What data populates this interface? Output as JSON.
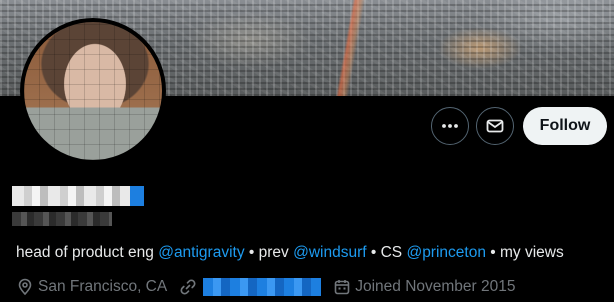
{
  "profile": {
    "bio": {
      "prefix": "head of product eng",
      "mention1": "@antigravity",
      "sep1": "• prev",
      "mention2": "@windsurf",
      "sep2": "• CS",
      "mention3": "@princeton",
      "suffix": "• my views"
    },
    "location": "San Francisco, CA",
    "joined": "Joined November 2015"
  },
  "actions": {
    "follow_label": "Follow"
  },
  "icons": {
    "more": "more-horizontal-icon",
    "message": "envelope-icon",
    "location": "location-pin-icon",
    "link": "link-icon",
    "calendar": "calendar-icon"
  },
  "colors": {
    "background": "#000000",
    "text": "#e7e9ea",
    "muted": "#71767b",
    "link": "#1d9bf0",
    "follow_bg": "#eff3f4"
  }
}
